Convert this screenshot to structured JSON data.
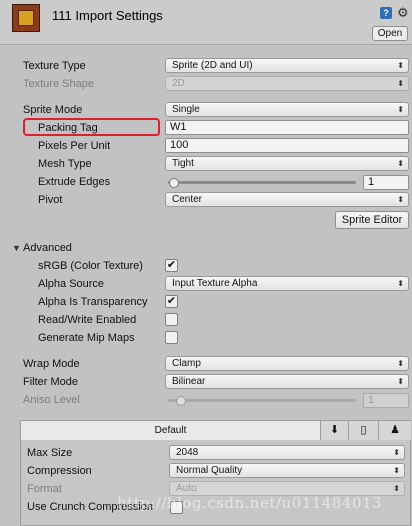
{
  "header": {
    "title": "111 Import Settings",
    "open_label": "Open",
    "help_glyph": "?",
    "gear_glyph": "⚙"
  },
  "fields": {
    "texture_type": {
      "label": "Texture Type",
      "value": "Sprite (2D and UI)"
    },
    "texture_shape": {
      "label": "Texture Shape",
      "value": "2D"
    },
    "sprite_mode": {
      "label": "Sprite Mode",
      "value": "Single"
    },
    "packing_tag": {
      "label": "Packing Tag",
      "value": "W1"
    },
    "pixels_per_unit": {
      "label": "Pixels Per Unit",
      "value": "100"
    },
    "mesh_type": {
      "label": "Mesh Type",
      "value": "Tight"
    },
    "extrude_edges": {
      "label": "Extrude Edges",
      "value": "1",
      "slider_fraction": 0.03
    },
    "pivot": {
      "label": "Pivot",
      "value": "Center"
    },
    "sprite_editor_label": "Sprite Editor"
  },
  "advanced": {
    "label": "Advanced",
    "srgb": {
      "label": "sRGB (Color Texture)",
      "checked": true
    },
    "alpha_source": {
      "label": "Alpha Source",
      "value": "Input Texture Alpha"
    },
    "alpha_is_transparency": {
      "label": "Alpha Is Transparency",
      "checked": true
    },
    "read_write": {
      "label": "Read/Write Enabled",
      "checked": false
    },
    "mip_maps": {
      "label": "Generate Mip Maps",
      "checked": false
    }
  },
  "wrap": {
    "wrap_mode": {
      "label": "Wrap Mode",
      "value": "Clamp"
    },
    "filter_mode": {
      "label": "Filter Mode",
      "value": "Bilinear"
    },
    "aniso_level": {
      "label": "Aniso Level",
      "value": "1",
      "slider_fraction": 0.07
    }
  },
  "platform": {
    "tab_default": "Default",
    "max_size": {
      "label": "Max Size",
      "value": "2048"
    },
    "compression": {
      "label": "Compression",
      "value": "Normal Quality"
    },
    "format": {
      "label": "Format",
      "value": "Auto"
    },
    "crunch": {
      "label": "Use Crunch Compression",
      "checked": false
    }
  },
  "check_glyph": "✔",
  "watermark": "http://blog.csdn.net/u011484013",
  "colors": {
    "highlight_border": "#e0202a",
    "panel_background": "#c2c2c2"
  }
}
